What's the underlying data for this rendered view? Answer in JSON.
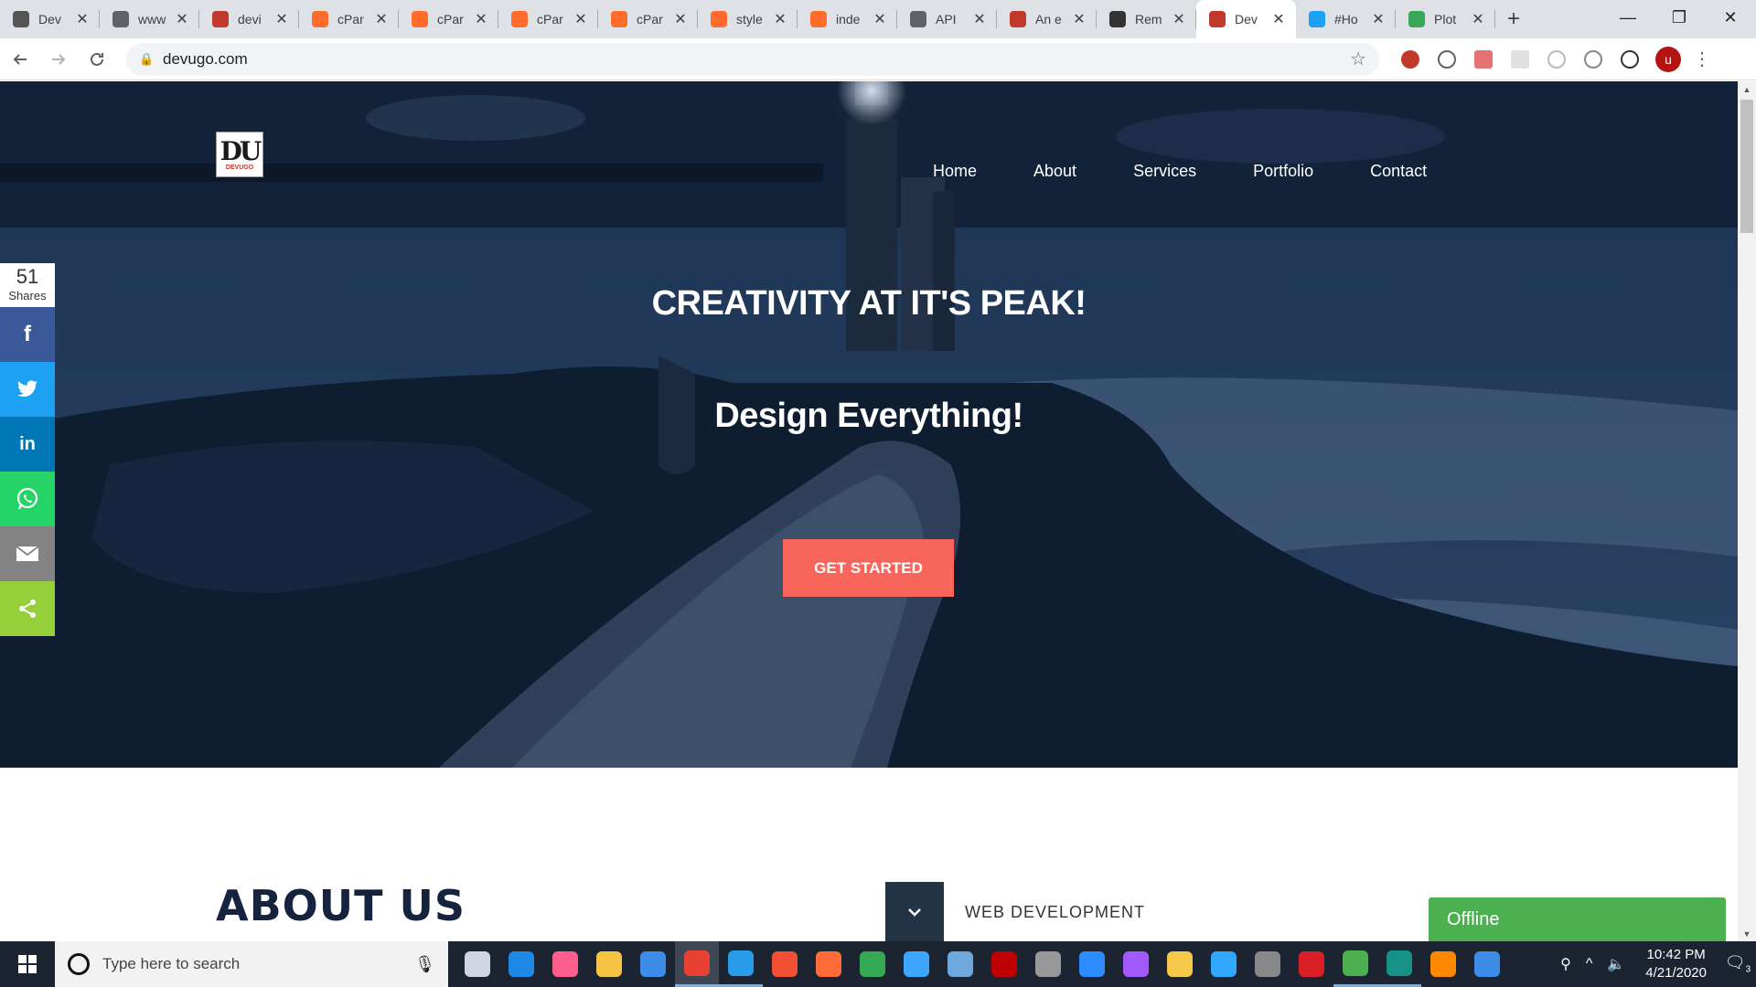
{
  "browser": {
    "tabs": [
      {
        "title": "Dev",
        "favicon_color": "#555555",
        "favicon": "person-icon"
      },
      {
        "title": "www",
        "favicon_color": "#5f6368",
        "favicon": "globe-icon"
      },
      {
        "title": "devi",
        "favicon_color": "#c0392b",
        "favicon": "phpmyadmin-icon"
      },
      {
        "title": "cPar",
        "favicon_color": "#ff6c2c",
        "favicon": "cpanel-icon"
      },
      {
        "title": "cPar",
        "favicon_color": "#ff6c2c",
        "favicon": "cpanel-icon"
      },
      {
        "title": "cPar",
        "favicon_color": "#ff6c2c",
        "favicon": "cpanel-icon"
      },
      {
        "title": "cPar",
        "favicon_color": "#ff6c2c",
        "favicon": "cpanel-icon"
      },
      {
        "title": "style",
        "favicon_color": "#ff6c2c",
        "favicon": "cpanel-icon"
      },
      {
        "title": "inde",
        "favicon_color": "#ff6c2c",
        "favicon": "cpanel-icon"
      },
      {
        "title": "API",
        "favicon_color": "#5f6368",
        "favicon": "globe-icon"
      },
      {
        "title": "An e",
        "favicon_color": "#c0392b",
        "favicon": "mascot-icon"
      },
      {
        "title": "Rem",
        "favicon_color": "#333333",
        "favicon": "graduation-cap-icon"
      },
      {
        "title": "Dev",
        "favicon_color": "#c0392b",
        "favicon": "devugo-icon",
        "active": true
      },
      {
        "title": "#Ho",
        "favicon_color": "#1da1f2",
        "favicon": "twitter-icon"
      },
      {
        "title": "Plot",
        "favicon_color": "#3aa757",
        "favicon": "px-icon"
      }
    ],
    "new_tab_label": "+",
    "url": "devugo.com",
    "profile_initial": "u",
    "window_controls": {
      "minimize": "—",
      "maximize": "❐",
      "close": "✕"
    }
  },
  "site": {
    "logo_text": "DU",
    "logo_sub": "DEVUGO",
    "nav": [
      "Home",
      "About",
      "Services",
      "Portfolio",
      "Contact"
    ],
    "headline": "CREATIVITY AT IT'S PEAK!",
    "subheadline": "Design Everything!",
    "cta_label": "GET STARTED",
    "about_heading": "ABOUT US",
    "accordion_label": "WEB DEVELOPMENT",
    "offline_label": "Offline"
  },
  "share_bar": {
    "count": "51",
    "count_label": "Shares",
    "buttons": [
      {
        "name": "facebook",
        "glyph": "f",
        "color": "#3b5998"
      },
      {
        "name": "twitter",
        "glyph": "🐦",
        "color": "#1da1f2"
      },
      {
        "name": "linkedin",
        "glyph": "in",
        "color": "#0077b5"
      },
      {
        "name": "whatsapp",
        "glyph": "✆",
        "color": "#25d366"
      },
      {
        "name": "email",
        "glyph": "✉",
        "color": "#848484"
      },
      {
        "name": "share",
        "glyph": "<",
        "color": "#95d03a"
      }
    ]
  },
  "taskbar": {
    "search_placeholder": "Type here to search",
    "apps": [
      {
        "name": "task-view",
        "color": "#cfd6df"
      },
      {
        "name": "edge",
        "color": "#1e88e5"
      },
      {
        "name": "itunes",
        "color": "#ff5e8c"
      },
      {
        "name": "file-explorer",
        "color": "#f4c542"
      },
      {
        "name": "mail",
        "color": "#3c8ce7"
      },
      {
        "name": "chrome",
        "color": "#e94235",
        "active": true
      },
      {
        "name": "vscode",
        "color": "#2a9be8",
        "running": true
      },
      {
        "name": "git",
        "color": "#f05033"
      },
      {
        "name": "postman",
        "color": "#ff6c37"
      },
      {
        "name": "maps",
        "color": "#34a853"
      },
      {
        "name": "cloud",
        "color": "#3ea6ff"
      },
      {
        "name": "network",
        "color": "#6fa8dc"
      },
      {
        "name": "filezilla",
        "color": "#bf0000"
      },
      {
        "name": "xampp",
        "color": "#999999"
      },
      {
        "name": "zoom",
        "color": "#2d8cff"
      },
      {
        "name": "figma",
        "color": "#a259ff"
      },
      {
        "name": "paint",
        "color": "#f7c948"
      },
      {
        "name": "photoshop",
        "color": "#31a8ff"
      },
      {
        "name": "app-1",
        "color": "#888888"
      },
      {
        "name": "creative-cloud",
        "color": "#da1f26"
      },
      {
        "name": "hotspot",
        "color": "#4caf50",
        "running": true
      },
      {
        "name": "gitkraken",
        "color": "#179287",
        "running": true
      },
      {
        "name": "vlc",
        "color": "#ff8800"
      },
      {
        "name": "help",
        "color": "#3c8ce7"
      }
    ],
    "time": "10:42 PM",
    "date": "4/21/2020",
    "notification_count": "3"
  }
}
